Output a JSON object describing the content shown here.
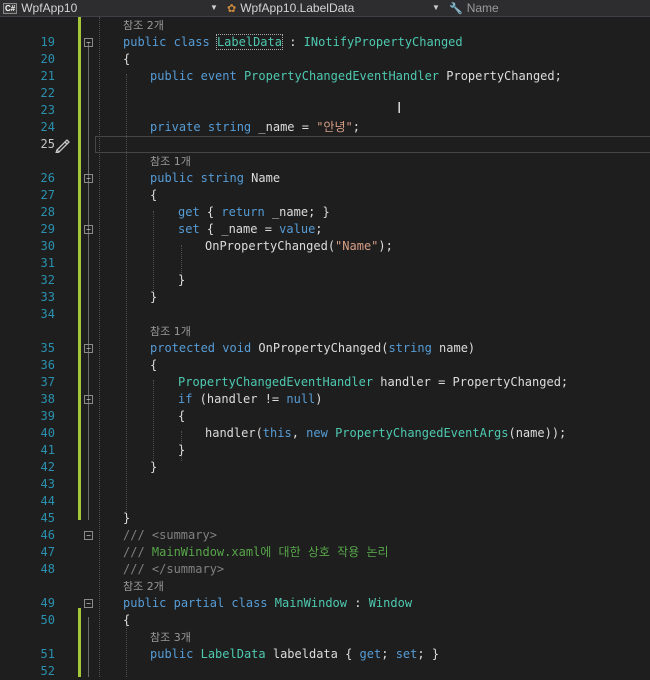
{
  "navbar": {
    "project": "WpfApp10",
    "type": "WpfApp10.LabelData",
    "member": "Name",
    "project_icon": "csharp-project-icon",
    "type_icon": "class-icon",
    "member_icon": "wrench-icon"
  },
  "lens": {
    "refs_2": "참조 2개",
    "refs_1": "참조 1개",
    "refs_3": "참조 3개"
  },
  "lines": {
    "n19": "19",
    "n20": "20",
    "n21": "21",
    "n22": "22",
    "n23": "23",
    "n24": "24",
    "n25": "25",
    "n26": "26",
    "n27": "27",
    "n28": "28",
    "n29": "29",
    "n30": "30",
    "n31": "31",
    "n32": "32",
    "n33": "33",
    "n34": "34",
    "n35": "35",
    "n36": "36",
    "n37": "37",
    "n38": "38",
    "n39": "39",
    "n40": "40",
    "n41": "41",
    "n42": "42",
    "n43": "43",
    "n44": "44",
    "n45": "45",
    "n46": "46",
    "n47": "47",
    "n48": "48",
    "n49": "49",
    "n50": "50",
    "n51": "51",
    "n52": "52"
  },
  "code": {
    "l19_public": "public",
    "l19_class": "class",
    "l19_name": "LabelData",
    "l19_colon": " : ",
    "l19_iface": "INotifyPropertyChanged",
    "l20": "{",
    "l21_public": "public",
    "l21_event": "event",
    "l21_type": "PropertyChangedEventHandler",
    "l21_name": " PropertyChanged;",
    "l24_private": "private",
    "l24_string": "string",
    "l24_name": " _name = ",
    "l24_value": "\"안녕\"",
    "l24_end": ";",
    "l26_public": "public",
    "l26_string": "string",
    "l26_name": " Name",
    "l27": "{",
    "l28_get": "get",
    "l28_open": " { ",
    "l28_return": "return",
    "l28_rest": " _name; }",
    "l29_set": "set",
    "l29_open": " { _name = ",
    "l29_value": "value",
    "l29_end": ";",
    "l30_call": "OnPropertyChanged(",
    "l30_arg": "\"Name\"",
    "l30_end": ");",
    "l32": "}",
    "l33": "}",
    "l35_protected": "protected",
    "l35_void": "void",
    "l35_method": " OnPropertyChanged(",
    "l35_string": "string",
    "l35_rest": " name)",
    "l36": "{",
    "l37_type": "PropertyChangedEventHandler",
    "l37_rest": " handler = PropertyChanged;",
    "l38_if": "if",
    "l38_open": " (handler != ",
    "l38_null": "null",
    "l38_close": ")",
    "l39": "{",
    "l40_call": "handler(",
    "l40_this": "this",
    "l40_comma": ", ",
    "l40_new": "new",
    "l40_type": "PropertyChangedEventArgs",
    "l40_rest": "(name));",
    "l41": "}",
    "l42": "}",
    "l45": "}",
    "l46_slashes": "/// ",
    "l46_tag": "<summary>",
    "l47_slashes": "/// ",
    "l47_text": "MainWindow.xaml에 대한 상호 작용 논리",
    "l48_slashes": "/// ",
    "l48_tag": "</summary>",
    "l49_public": "public",
    "l49_partial": "partial",
    "l49_class": "class",
    "l49_name": " MainWindow",
    "l49_colon": " : ",
    "l49_base": "Window",
    "l50": "{",
    "l51_public": "public",
    "l51_type": "LabelData",
    "l51_name": " labeldata { ",
    "l51_get": "get",
    "l51_mid": "; ",
    "l51_set": "set",
    "l51_end": "; }"
  },
  "colors": {
    "keyword": "#569cd6",
    "type": "#4ec9b0",
    "string": "#d69d85",
    "comment": "#57a64a",
    "line_number": "#2b91af",
    "saved_change_marker": "#a4c639",
    "background": "#1e1e1e"
  }
}
